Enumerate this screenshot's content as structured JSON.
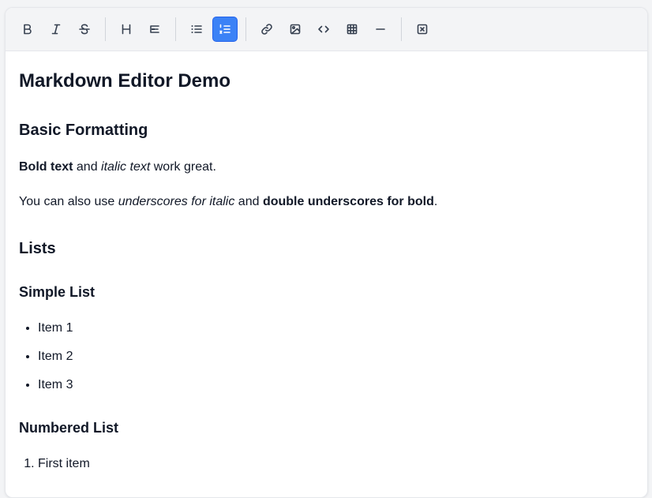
{
  "toolbar": {
    "buttons": [
      {
        "name": "bold-button",
        "icon": "bold-icon"
      },
      {
        "name": "italic-button",
        "icon": "italic-icon"
      },
      {
        "name": "strikethrough-button",
        "icon": "strikethrough-icon"
      },
      {
        "name": "heading-button",
        "icon": "heading-icon"
      },
      {
        "name": "align-button",
        "icon": "align-left-icon"
      },
      {
        "name": "bullet-list-button",
        "icon": "bullet-list-icon"
      },
      {
        "name": "numbered-list-button",
        "icon": "numbered-list-icon",
        "active": true
      },
      {
        "name": "link-button",
        "icon": "link-icon"
      },
      {
        "name": "image-button",
        "icon": "image-icon"
      },
      {
        "name": "code-button",
        "icon": "code-icon"
      },
      {
        "name": "table-button",
        "icon": "table-icon"
      },
      {
        "name": "horizontal-rule-button",
        "icon": "minus-icon"
      },
      {
        "name": "clear-formatting-button",
        "icon": "clear-format-icon"
      }
    ],
    "active_color": "#3b82f6"
  },
  "doc": {
    "title": "Markdown Editor Demo",
    "basic_heading": "Basic Formatting",
    "p1": {
      "bold": "Bold text",
      "t1": " and ",
      "italic": "italic text",
      "t2": " work great."
    },
    "p2": {
      "t1": "You can also use ",
      "italic": "underscores for italic",
      "t2": " and ",
      "bold": "double underscores for bold",
      "t3": "."
    },
    "lists_heading": "Lists",
    "simple_heading": "Simple List",
    "simple_items": [
      "Item 1",
      "Item 2",
      "Item 3"
    ],
    "numbered_heading": "Numbered List",
    "numbered_items": [
      "First item"
    ]
  }
}
